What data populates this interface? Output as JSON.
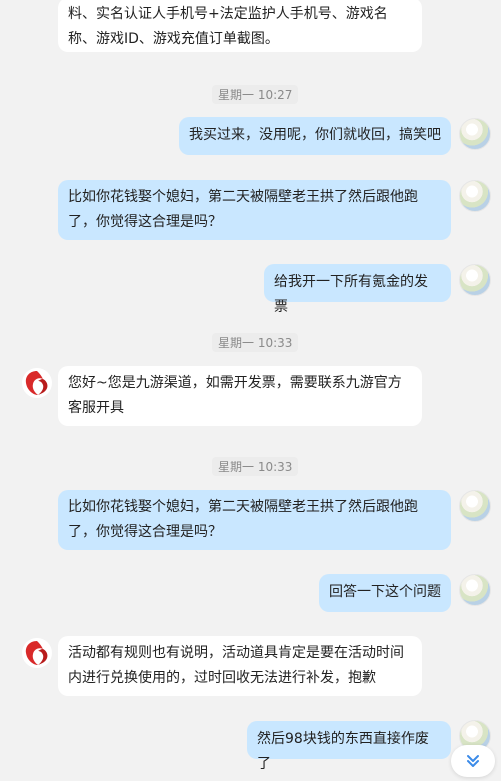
{
  "messages": [
    {
      "side": "left",
      "text": "料、实名认证人手机号+法定监护人手机号、游戏名称、游戏ID、游戏充值订单截图。"
    },
    {
      "side": "right",
      "text": "我买过来，没用呢，你们就收回，搞笑吧"
    },
    {
      "side": "right",
      "text": "比如你花钱娶个媳妇，第二天被隔壁老王拱了然后跟他跑了，你觉得这合理是吗？"
    },
    {
      "side": "right",
      "text": "给我开一下所有氪金的发票"
    },
    {
      "side": "left",
      "text": "您好~您是九游渠道，如需开发票，需要联系九游官方客服开具"
    },
    {
      "side": "right",
      "text": "比如你花钱娶个媳妇，第二天被隔壁老王拱了然后跟他跑了，你觉得这合理是吗？"
    },
    {
      "side": "right",
      "text": "回答一下这个问题"
    },
    {
      "side": "left",
      "text": "活动都有规则也有说明，活动道具肯定是要在活动时间内进行兑换使用的，过时回收无法进行补发，抱歉"
    },
    {
      "side": "right",
      "text": "然后98块钱的东西直接作废了"
    }
  ],
  "timestamps": [
    "星期一 10:27",
    "星期一 10:33",
    "星期一 10:33"
  ],
  "icons": {
    "user_avatar": "user-avatar-icon",
    "bot_avatar": "service-avatar-icon",
    "scroll": "chevron-double-down-icon"
  },
  "colors": {
    "background": "#f2f2f2",
    "left_bubble": "#ffffff",
    "right_bubble": "#c9e7ff",
    "timestamp_text": "#8a8a8a",
    "bot_logo": "#d92a2a",
    "scroll_icon": "#3b8be8"
  }
}
